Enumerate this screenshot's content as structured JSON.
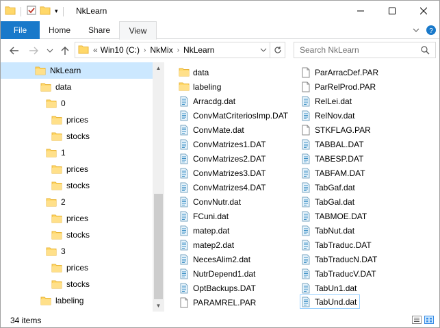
{
  "window": {
    "title": "NkLearn",
    "minimize_glyph": "—",
    "maximize_glyph": "☐",
    "close_glyph": "✕"
  },
  "ribbon": {
    "file": "File",
    "home": "Home",
    "share": "Share",
    "view": "View"
  },
  "address": {
    "overflow": "«",
    "segments": [
      "Win10 (C:)",
      "NkMix",
      "NkLearn"
    ],
    "separator": "›",
    "refresh_glyph": "↻",
    "dropdown_glyph": "⌄"
  },
  "search": {
    "placeholder": "Search NkLearn"
  },
  "tree": {
    "items": [
      {
        "label": "NkLearn",
        "depth": 0,
        "selected": true
      },
      {
        "label": "data",
        "depth": 1
      },
      {
        "label": "0",
        "depth": 2
      },
      {
        "label": "prices",
        "depth": 3
      },
      {
        "label": "stocks",
        "depth": 3
      },
      {
        "label": "1",
        "depth": 2
      },
      {
        "label": "prices",
        "depth": 3
      },
      {
        "label": "stocks",
        "depth": 3
      },
      {
        "label": "2",
        "depth": 2
      },
      {
        "label": "prices",
        "depth": 3
      },
      {
        "label": "stocks",
        "depth": 3
      },
      {
        "label": "3",
        "depth": 2
      },
      {
        "label": "prices",
        "depth": 3
      },
      {
        "label": "stocks",
        "depth": 3
      },
      {
        "label": "labeling",
        "depth": 1
      }
    ]
  },
  "files": {
    "col1": [
      {
        "name": "data",
        "icon": "folder-icon"
      },
      {
        "name": "labeling",
        "icon": "folder-icon"
      },
      {
        "name": "Arracdg.dat",
        "icon": "dat-file-icon"
      },
      {
        "name": "ConvMatCriteriosImp.DAT",
        "icon": "dat-file-icon"
      },
      {
        "name": "ConvMate.dat",
        "icon": "dat-file-icon"
      },
      {
        "name": "ConvMatrizes1.DAT",
        "icon": "dat-file-icon"
      },
      {
        "name": "ConvMatrizes2.DAT",
        "icon": "dat-file-icon"
      },
      {
        "name": "ConvMatrizes3.DAT",
        "icon": "dat-file-icon"
      },
      {
        "name": "ConvMatrizes4.DAT",
        "icon": "dat-file-icon"
      },
      {
        "name": "ConvNutr.dat",
        "icon": "dat-file-icon"
      },
      {
        "name": "FCuni.dat",
        "icon": "dat-file-icon"
      },
      {
        "name": "matep.dat",
        "icon": "dat-file-icon"
      },
      {
        "name": "matep2.dat",
        "icon": "dat-file-icon"
      },
      {
        "name": "NecesAlim2.dat",
        "icon": "dat-file-icon"
      },
      {
        "name": "NutrDepend1.dat",
        "icon": "dat-file-icon"
      },
      {
        "name": "OptBackups.DAT",
        "icon": "dat-file-icon"
      },
      {
        "name": "PARAMREL.PAR",
        "icon": "blank-file-icon"
      }
    ],
    "col2": [
      {
        "name": "ParArracDef.PAR",
        "icon": "blank-file-icon"
      },
      {
        "name": "ParRelProd.PAR",
        "icon": "blank-file-icon"
      },
      {
        "name": "RelLei.dat",
        "icon": "dat-file-icon"
      },
      {
        "name": "RelNov.dat",
        "icon": "dat-file-icon"
      },
      {
        "name": "STKFLAG.PAR",
        "icon": "blank-file-icon"
      },
      {
        "name": "TABBAL.DAT",
        "icon": "dat-file-icon"
      },
      {
        "name": "TABESP.DAT",
        "icon": "dat-file-icon"
      },
      {
        "name": "TABFAM.DAT",
        "icon": "dat-file-icon"
      },
      {
        "name": "TabGaf.dat",
        "icon": "dat-file-icon"
      },
      {
        "name": "TabGal.dat",
        "icon": "dat-file-icon"
      },
      {
        "name": "TABMOE.DAT",
        "icon": "dat-file-icon"
      },
      {
        "name": "TabNut.dat",
        "icon": "dat-file-icon"
      },
      {
        "name": "TabTraduc.DAT",
        "icon": "dat-file-icon"
      },
      {
        "name": "TabTraducN.DAT",
        "icon": "dat-file-icon"
      },
      {
        "name": "TabTraducV.DAT",
        "icon": "dat-file-icon"
      },
      {
        "name": "TabUn1.dat",
        "icon": "dat-file-icon"
      },
      {
        "name": "TabUnd.dat",
        "icon": "dat-file-icon",
        "selected": true
      }
    ]
  },
  "status": {
    "count": "34 items"
  },
  "colors": {
    "accent": "#1979ca",
    "selection": "#cce8ff",
    "folder": "#ffd86a",
    "folder_dark": "#e8b53a"
  }
}
